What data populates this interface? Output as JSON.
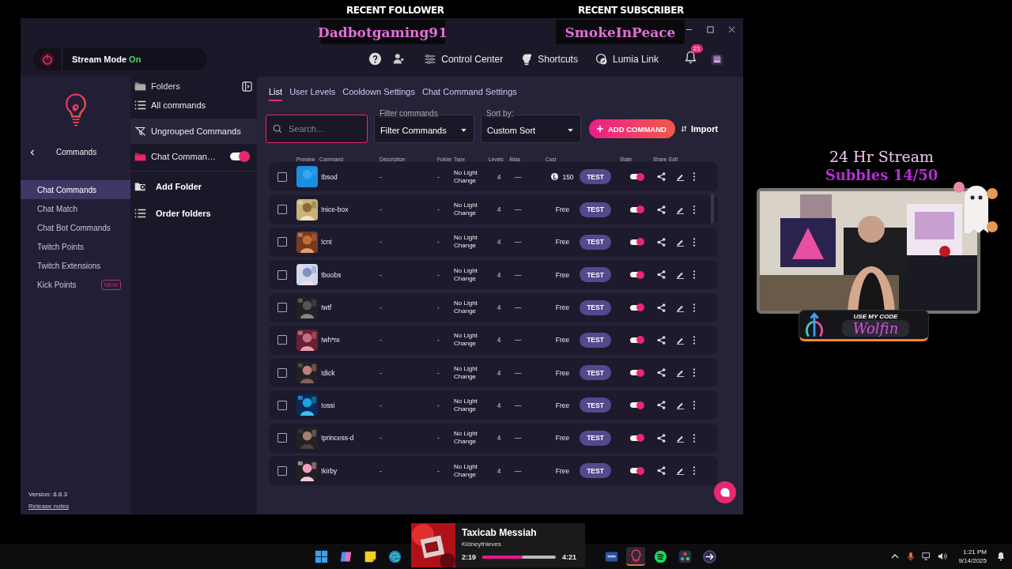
{
  "overlay": {
    "follower": {
      "label": "RECENT FOLLOWER",
      "name": "Dadbotgaming91"
    },
    "subscriber": {
      "label": "RECENT SUBSCRIBER",
      "name": "SmokeInPeace"
    },
    "stream_title": "24 Hr Stream",
    "goal": "Subbles 14/50",
    "code_label": "USE MY CODE",
    "code": "Wolfin"
  },
  "header": {
    "stream_mode": {
      "label": "Stream Mode",
      "state": "On"
    },
    "nav": [
      {
        "kind": "control",
        "label": "Control Center"
      },
      {
        "kind": "shortcuts",
        "label": "Shortcuts"
      },
      {
        "kind": "link",
        "label": "Lumia Link"
      }
    ],
    "notifications": "21"
  },
  "sidebar": {
    "title": "Commands",
    "items": [
      {
        "label": "Chat Commands",
        "selected": true
      },
      {
        "label": "Chat Match",
        "selected": false
      },
      {
        "label": "Chat Bot Commands",
        "selected": false
      },
      {
        "label": "Twitch Points",
        "selected": false
      },
      {
        "label": "Twitch Extensions",
        "selected": false
      },
      {
        "label": "Kick Points",
        "selected": false,
        "badge": "NEW"
      }
    ],
    "version": "Version: 8.8.3",
    "release_notes": "Release notes"
  },
  "folders": {
    "title": "Folders",
    "items": [
      {
        "kind": "all",
        "label": "All commands",
        "selected": false
      },
      {
        "kind": "ungrouped",
        "label": "Ungrouped Commands",
        "selected": true
      },
      {
        "kind": "folder",
        "label": "Chat Comman…",
        "selected": false,
        "on": true
      }
    ],
    "actions": [
      {
        "kind": "add",
        "label": "Add Folder"
      },
      {
        "kind": "order",
        "label": "Order folders"
      }
    ]
  },
  "tabs": [
    {
      "label": "List",
      "selected": true
    },
    {
      "label": "User Levels",
      "selected": false
    },
    {
      "label": "Cooldown Settings",
      "selected": false
    },
    {
      "label": "Chat Command Settings",
      "selected": false
    }
  ],
  "toolbar": {
    "search": {
      "placeholder": "Search..."
    },
    "filter": {
      "label": "Filter commands",
      "value": "Filter Commands"
    },
    "sort": {
      "label": "Sort by:",
      "value": "Custom Sort"
    },
    "add_button": "ADD COMMAND",
    "import_button": "Import"
  },
  "table": {
    "columns": [
      "Preview",
      "Command",
      "Description",
      "Folder",
      "Type",
      "Levels",
      "Alias",
      "Cost",
      "State",
      "Share",
      "Edit"
    ],
    "rows": [
      {
        "checked": false,
        "command": "!bsod",
        "description": "-",
        "folder": "-",
        "type": "No Light Change",
        "levels": "4",
        "alias": "—",
        "cost": {
          "kind": "points",
          "text": "150"
        },
        "test": "TEST",
        "on": true
      },
      {
        "checked": false,
        "command": "!nice-box",
        "description": "-",
        "folder": "-",
        "type": "No Light Change",
        "levels": "4",
        "alias": "—",
        "cost": {
          "kind": "free",
          "text": "Free"
        },
        "test": "TEST",
        "on": true
      },
      {
        "checked": false,
        "command": "!cnt",
        "description": "-",
        "folder": "-",
        "type": "No Light Change",
        "levels": "4",
        "alias": "—",
        "cost": {
          "kind": "free",
          "text": "Free"
        },
        "test": "TEST",
        "on": true
      },
      {
        "checked": false,
        "command": "!boobs",
        "description": "-",
        "folder": "-",
        "type": "No Light Change",
        "levels": "4",
        "alias": "—",
        "cost": {
          "kind": "free",
          "text": "Free"
        },
        "test": "TEST",
        "on": true
      },
      {
        "checked": false,
        "command": "!wtf",
        "description": "-",
        "folder": "-",
        "type": "No Light Change",
        "levels": "4",
        "alias": "—",
        "cost": {
          "kind": "free",
          "text": "Free"
        },
        "test": "TEST",
        "on": true
      },
      {
        "checked": false,
        "command": "!wh*re",
        "description": "-",
        "folder": "-",
        "type": "No Light Change",
        "levels": "4",
        "alias": "—",
        "cost": {
          "kind": "free",
          "text": "Free"
        },
        "test": "TEST",
        "on": true
      },
      {
        "checked": false,
        "command": "!dick",
        "description": "-",
        "folder": "-",
        "type": "No Light Change",
        "levels": "4",
        "alias": "—",
        "cost": {
          "kind": "free",
          "text": "Free"
        },
        "test": "TEST",
        "on": true
      },
      {
        "checked": false,
        "command": "!ossi",
        "description": "-",
        "folder": "-",
        "type": "No Light Change",
        "levels": "4",
        "alias": "—",
        "cost": {
          "kind": "free",
          "text": "Free"
        },
        "test": "TEST",
        "on": true
      },
      {
        "checked": false,
        "command": "!princess-d",
        "description": "-",
        "folder": "-",
        "type": "No Light Change",
        "levels": "4",
        "alias": "—",
        "cost": {
          "kind": "free",
          "text": "Free"
        },
        "test": "TEST",
        "on": true
      },
      {
        "checked": false,
        "command": "!kirby",
        "description": "-",
        "folder": "-",
        "type": "No Light Change",
        "levels": "4",
        "alias": "—",
        "cost": {
          "kind": "free",
          "text": "Free"
        },
        "test": "TEST",
        "on": true
      }
    ]
  },
  "taskbar": {
    "apps": [
      {
        "kind": "start",
        "selected": false
      },
      {
        "kind": "copilot",
        "selected": false
      },
      {
        "kind": "notes",
        "selected": false
      },
      {
        "kind": "edge",
        "selected": false
      },
      {
        "kind": "mold",
        "selected": false
      },
      {
        "kind": "lumia",
        "selected": true
      },
      {
        "kind": "spotify",
        "selected": false
      },
      {
        "kind": "resolve",
        "selected": false
      },
      {
        "kind": "arrow",
        "selected": false
      }
    ],
    "media": {
      "title": "Taxicab Messiah",
      "artist": "Kidneythieves",
      "elapsed": "2:19",
      "level": 0.55,
      "total": "4:21"
    },
    "time": "1:21 PM",
    "date": "9/14/2025"
  }
}
